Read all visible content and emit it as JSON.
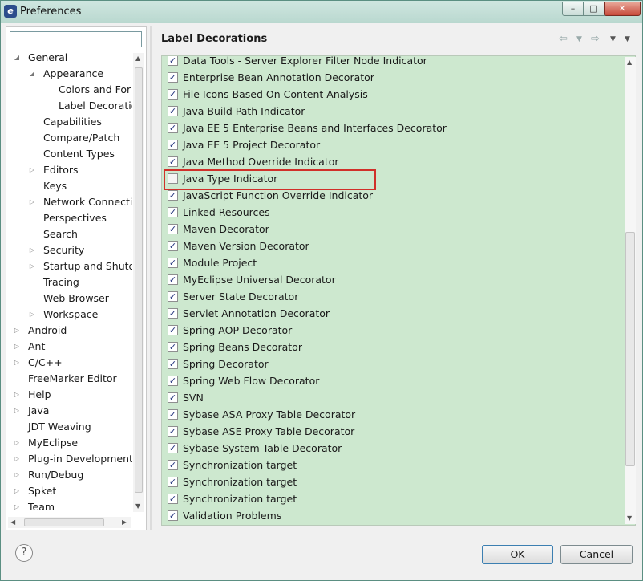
{
  "window": {
    "title": "Preferences",
    "min_icon": "minimize-icon",
    "max_icon": "maximize-icon",
    "close_icon": "close-icon"
  },
  "filter": {
    "value": "",
    "placeholder": ""
  },
  "tree": [
    {
      "label": "General",
      "level": 0,
      "twisty": "open"
    },
    {
      "label": "Appearance",
      "level": 1,
      "twisty": "open"
    },
    {
      "label": "Colors and For",
      "level": 2,
      "twisty": ""
    },
    {
      "label": "Label Decoratio",
      "level": 2,
      "twisty": "",
      "selected": true
    },
    {
      "label": "Capabilities",
      "level": 1,
      "twisty": ""
    },
    {
      "label": "Compare/Patch",
      "level": 1,
      "twisty": ""
    },
    {
      "label": "Content Types",
      "level": 1,
      "twisty": ""
    },
    {
      "label": "Editors",
      "level": 1,
      "twisty": "closed"
    },
    {
      "label": "Keys",
      "level": 1,
      "twisty": ""
    },
    {
      "label": "Network Connecti",
      "level": 1,
      "twisty": "closed"
    },
    {
      "label": "Perspectives",
      "level": 1,
      "twisty": ""
    },
    {
      "label": "Search",
      "level": 1,
      "twisty": ""
    },
    {
      "label": "Security",
      "level": 1,
      "twisty": "closed"
    },
    {
      "label": "Startup and Shutd",
      "level": 1,
      "twisty": "closed"
    },
    {
      "label": "Tracing",
      "level": 1,
      "twisty": ""
    },
    {
      "label": "Web Browser",
      "level": 1,
      "twisty": ""
    },
    {
      "label": "Workspace",
      "level": 1,
      "twisty": "closed"
    },
    {
      "label": "Android",
      "level": 0,
      "twisty": "closed"
    },
    {
      "label": "Ant",
      "level": 0,
      "twisty": "closed"
    },
    {
      "label": "C/C++",
      "level": 0,
      "twisty": "closed"
    },
    {
      "label": "FreeMarker Editor",
      "level": 0,
      "twisty": ""
    },
    {
      "label": "Help",
      "level": 0,
      "twisty": "closed"
    },
    {
      "label": "Java",
      "level": 0,
      "twisty": "closed"
    },
    {
      "label": "JDT Weaving",
      "level": 0,
      "twisty": ""
    },
    {
      "label": "MyEclipse",
      "level": 0,
      "twisty": "closed"
    },
    {
      "label": "Plug-in Development",
      "level": 0,
      "twisty": "closed"
    },
    {
      "label": "Run/Debug",
      "level": 0,
      "twisty": "closed"
    },
    {
      "label": "Spket",
      "level": 0,
      "twisty": "closed"
    },
    {
      "label": "Team",
      "level": 0,
      "twisty": "closed"
    }
  ],
  "page": {
    "title": "Label Decorations"
  },
  "decorators": [
    {
      "label": "Data Tools - Server Explorer Filter Node Indicator",
      "checked": true
    },
    {
      "label": "Enterprise Bean Annotation Decorator",
      "checked": true
    },
    {
      "label": "File Icons Based On Content Analysis",
      "checked": true
    },
    {
      "label": "Java Build Path Indicator",
      "checked": true
    },
    {
      "label": "Java EE 5 Enterprise Beans and Interfaces Decorator",
      "checked": true
    },
    {
      "label": "Java EE 5 Project Decorator",
      "checked": true
    },
    {
      "label": "Java Method Override Indicator",
      "checked": true
    },
    {
      "label": "Java Type Indicator",
      "checked": false,
      "highlighted": true
    },
    {
      "label": "JavaScript Function Override Indicator",
      "checked": true
    },
    {
      "label": "Linked Resources",
      "checked": true
    },
    {
      "label": "Maven Decorator",
      "checked": true
    },
    {
      "label": "Maven Version Decorator",
      "checked": true
    },
    {
      "label": "Module Project",
      "checked": true
    },
    {
      "label": "MyEclipse Universal Decorator",
      "checked": true
    },
    {
      "label": "Server State Decorator",
      "checked": true
    },
    {
      "label": "Servlet Annotation Decorator",
      "checked": true
    },
    {
      "label": "Spring AOP Decorator",
      "checked": true
    },
    {
      "label": "Spring Beans Decorator",
      "checked": true
    },
    {
      "label": "Spring Decorator",
      "checked": true
    },
    {
      "label": "Spring Web Flow Decorator",
      "checked": true
    },
    {
      "label": "SVN",
      "checked": true
    },
    {
      "label": "Sybase ASA Proxy Table Decorator",
      "checked": true
    },
    {
      "label": "Sybase ASE Proxy Table Decorator",
      "checked": true
    },
    {
      "label": "Sybase System Table Decorator",
      "checked": true
    },
    {
      "label": "Synchronization target",
      "checked": true
    },
    {
      "label": "Synchronization target",
      "checked": true
    },
    {
      "label": "Synchronization target",
      "checked": true
    },
    {
      "label": "Validation Problems",
      "checked": true
    }
  ],
  "buttons": {
    "ok": "OK",
    "cancel": "Cancel",
    "help": "?"
  },
  "colors": {
    "list_bg": "#cde8cf",
    "highlight": "#d0302a",
    "titlebar": "#b9d8cf"
  }
}
